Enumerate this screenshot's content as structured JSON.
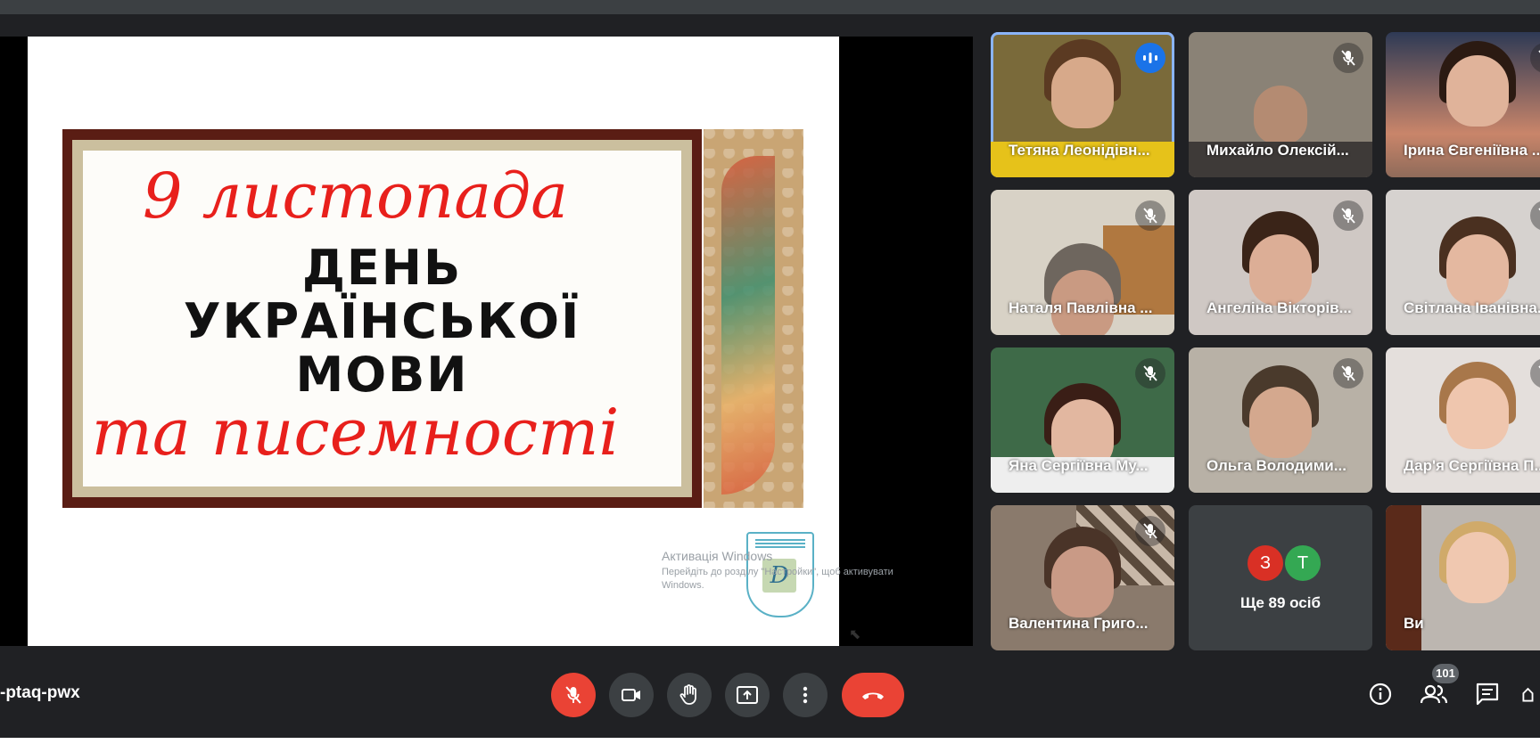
{
  "meeting": {
    "code": "-ptaq-pwx"
  },
  "slide": {
    "line1": "9 листопада",
    "line2": "ДЕНЬ",
    "line3": "УКРАЇНСЬКОЇ",
    "line4": "МОВИ",
    "line5": "та писемності"
  },
  "overlay": {
    "activation_title": "Активація Windows",
    "activation_text": "Перейдіть до розділу \"Настройки\", щоб активувати Windows."
  },
  "participants": [
    {
      "name": "Тетяна Леонідівн...",
      "state": "speaking"
    },
    {
      "name": "Михайло Олексій...",
      "state": "muted"
    },
    {
      "name": "Ірина Євгеніївна ...",
      "state": "muted"
    },
    {
      "name": "Наталя Павлівна ...",
      "state": "muted"
    },
    {
      "name": "Ангеліна Вікторів...",
      "state": "muted"
    },
    {
      "name": "Світлана Іванівна...",
      "state": "muted"
    },
    {
      "name": "Яна Сергіївна Му...",
      "state": "muted"
    },
    {
      "name": "Ольга Володими...",
      "state": "muted"
    },
    {
      "name": "Дар'я Сергіївна П...",
      "state": "muted"
    },
    {
      "name": "Валентина Григо...",
      "state": "muted"
    },
    {
      "name": "Ви",
      "state": "self"
    }
  ],
  "more_people": {
    "label": "Ще 89 осіб",
    "initials": [
      {
        "letter": "З",
        "color": "#d93025"
      },
      {
        "letter": "Т",
        "color": "#34a853"
      }
    ]
  },
  "controls": {
    "participants_count": "101"
  },
  "colors": {
    "background": "#202124",
    "tile": "#3c4043",
    "end_call": "#ea4335",
    "active_border": "#8ab4f8",
    "speaking": "#1a73e8"
  }
}
